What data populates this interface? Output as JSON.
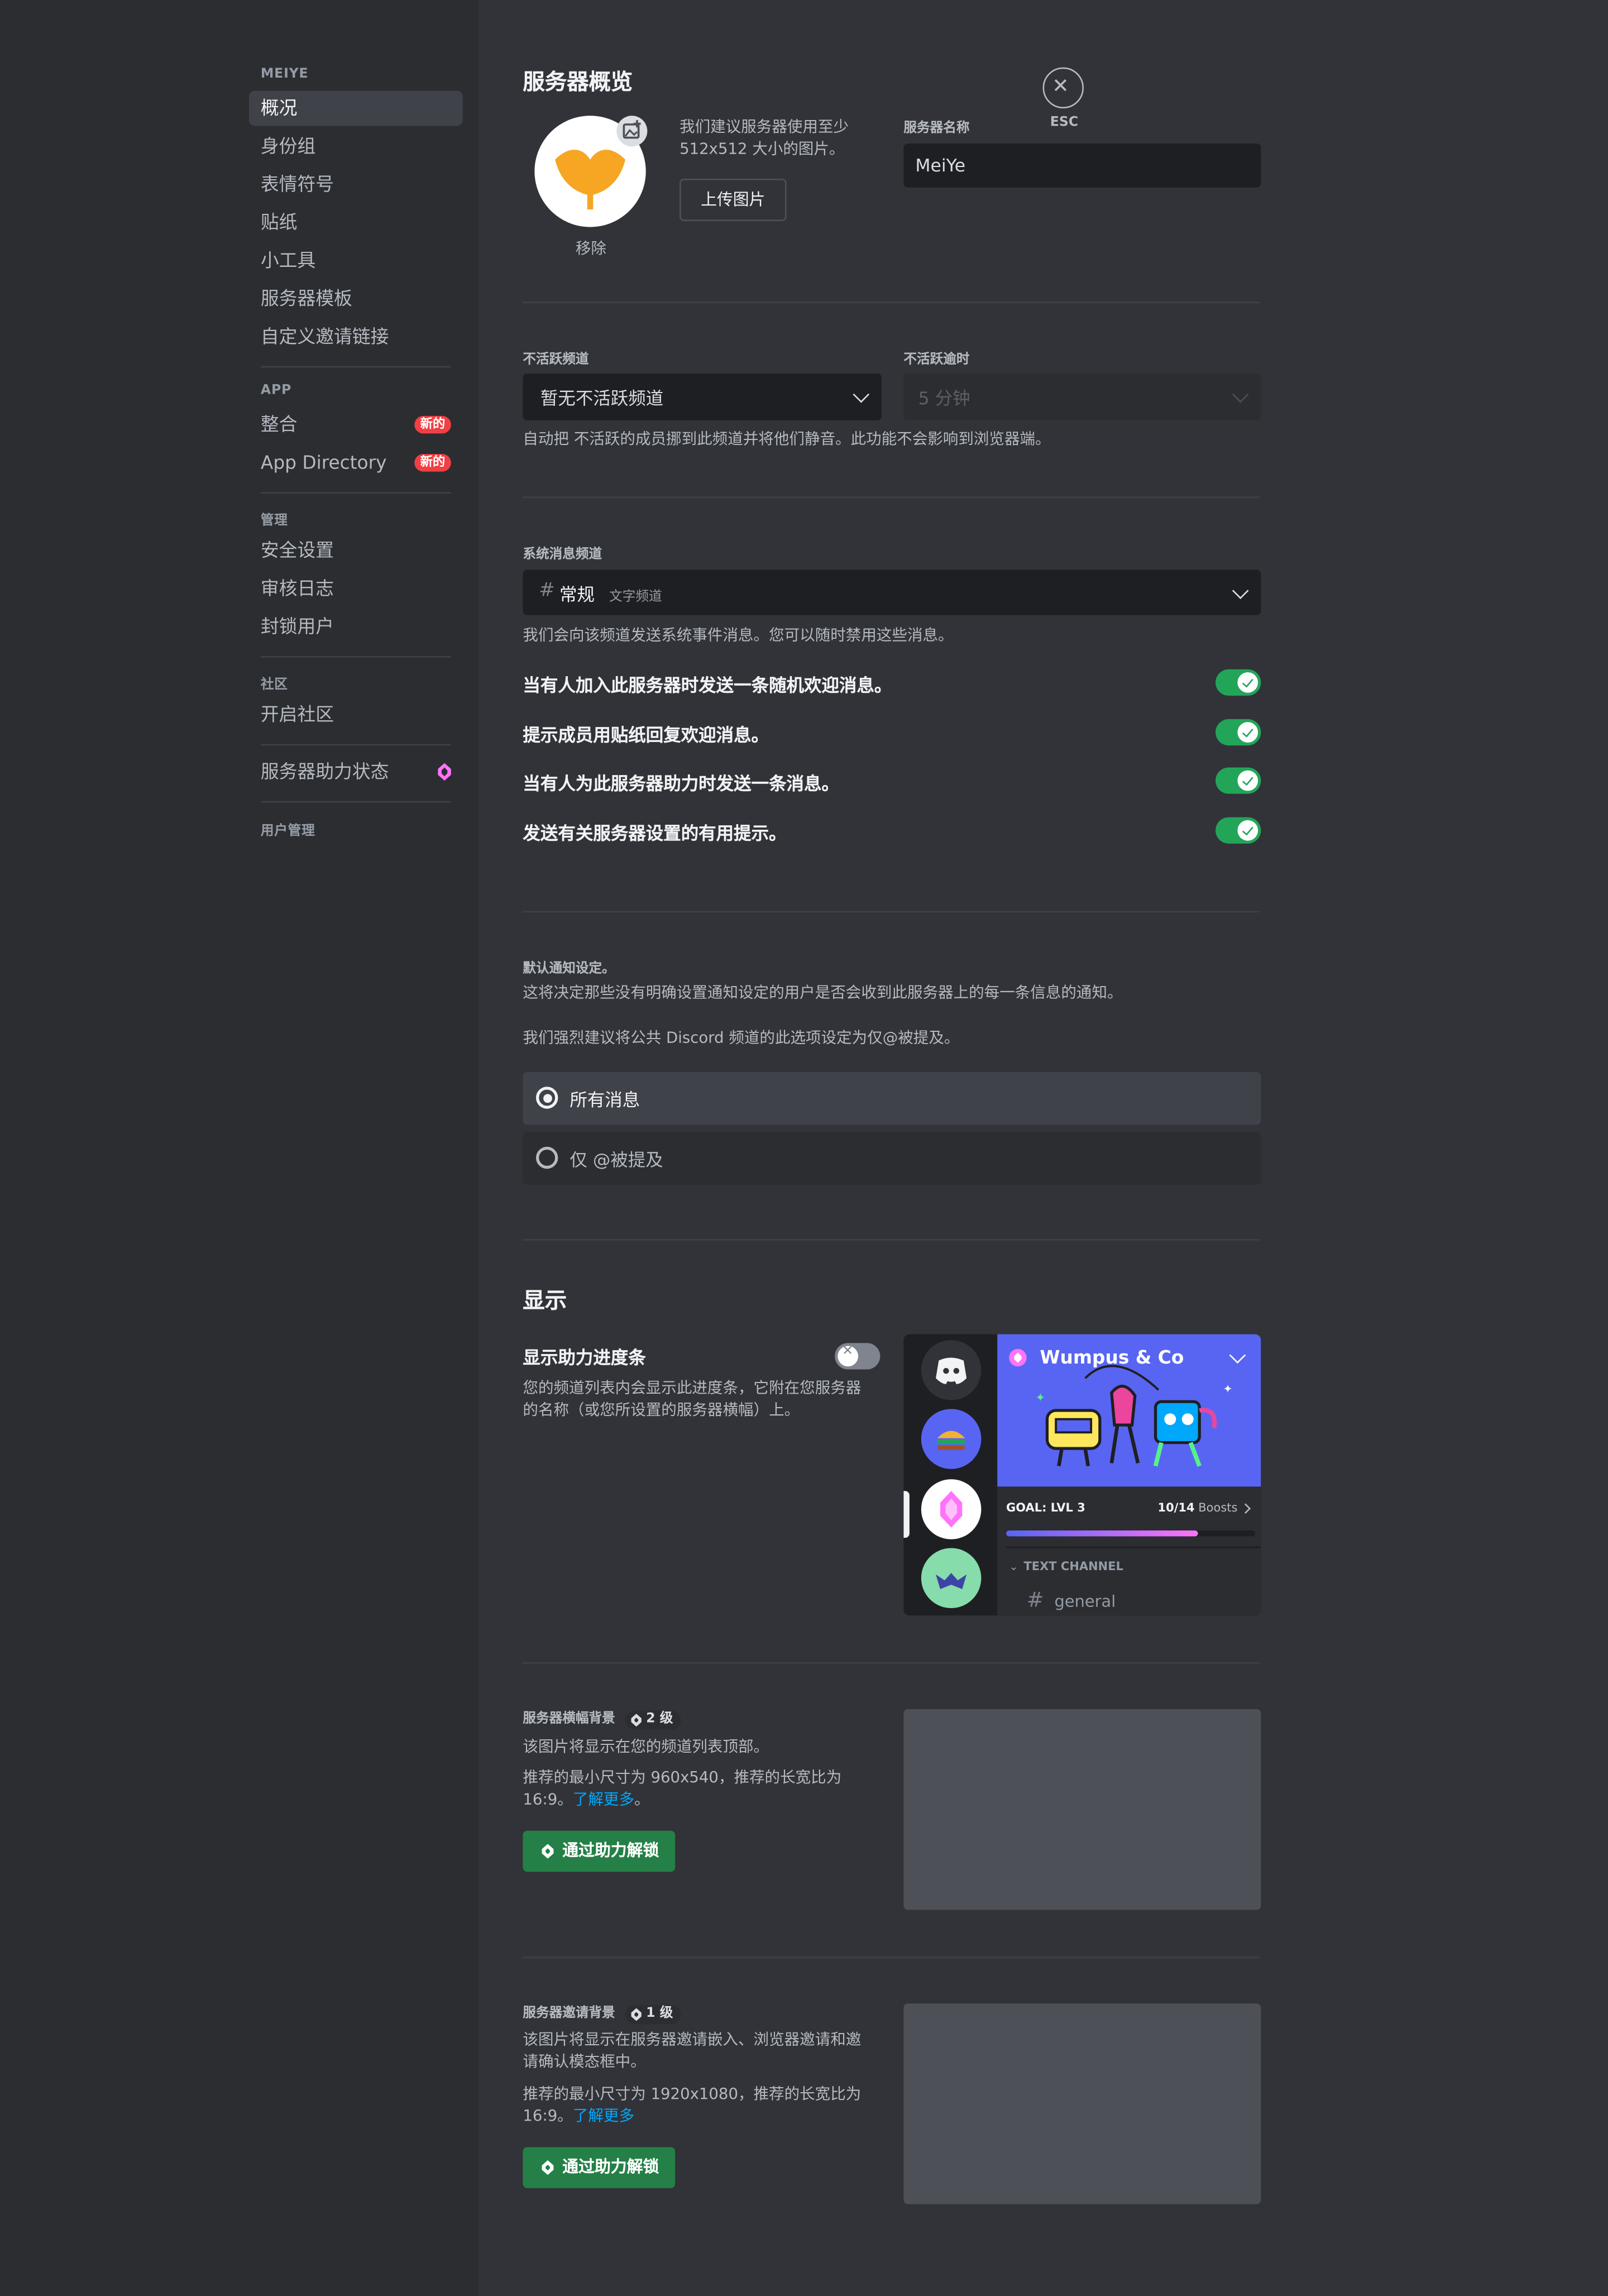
{
  "sidebar": {
    "server_header": "MEIYE",
    "items": [
      {
        "label": "概况"
      },
      {
        "label": "身份组"
      },
      {
        "label": "表情符号"
      },
      {
        "label": "贴纸"
      },
      {
        "label": "小工具"
      },
      {
        "label": "服务器模板"
      },
      {
        "label": "自定义邀请链接"
      }
    ],
    "app_header": "APP",
    "app_items": [
      {
        "label": "整合",
        "badge": "新的"
      },
      {
        "label": "App Directory",
        "badge": "新的"
      }
    ],
    "manage_header": "管理",
    "manage_items": [
      {
        "label": "安全设置"
      },
      {
        "label": "审核日志"
      },
      {
        "label": "封锁用户"
      }
    ],
    "community_header": "社区",
    "community_items": [
      {
        "label": "开启社区"
      }
    ],
    "boost_status": "服务器助力状态",
    "user_mgmt_header": "用户管理"
  },
  "overview": {
    "title": "服务器概览",
    "remove": "移除",
    "upload_hint": "我们建议服务器使用至少 512x512 大小的图片。",
    "upload_button": "上传图片",
    "server_name_label": "服务器名称",
    "server_name_value": "MeiYe",
    "esc": "ESC"
  },
  "inactive": {
    "channel_label": "不活跃频道",
    "channel_value": "暂无不活跃频道",
    "timeout_label": "不活跃逾时",
    "timeout_value": "5 分钟",
    "hint": "自动把 不活跃的成员挪到此频道并将他们静音。此功能不会影响到浏览器端。"
  },
  "system": {
    "label": "系统消息频道",
    "channel_name": "常规",
    "channel_type": "文字频道",
    "hint": "我们会向该频道发送系统事件消息。您可以随时禁用这些消息。",
    "toggles": [
      {
        "label": "当有人加入此服务器时发送一条随机欢迎消息。",
        "on": true
      },
      {
        "label": "提示成员用贴纸回复欢迎消息。",
        "on": true
      },
      {
        "label": "当有人为此服务器助力时发送一条消息。",
        "on": true
      },
      {
        "label": "发送有关服务器设置的有用提示。",
        "on": true
      }
    ]
  },
  "notifications": {
    "label": "默认通知设定。",
    "desc1": "这将决定那些没有明确设置通知设定的用户是否会收到此服务器上的每一条信息的通知。",
    "desc2": "我们强烈建议将公共 Discord 频道的此选项设定为仅@被提及。",
    "options": [
      {
        "label": "所有消息",
        "selected": true
      },
      {
        "label": "仅 @被提及",
        "selected": false
      }
    ]
  },
  "display": {
    "title": "显示",
    "progress_label": "显示助力进度条",
    "progress_on": false,
    "progress_desc": "您的频道列表内会显示此进度条，它附在您服务器的名称（或您所设置的服务器横幅）上。",
    "preview": {
      "server_name": "Wumpus & Co",
      "goal": "GOAL: LVL 3",
      "boosts_count": "10/14",
      "boosts_word": "Boosts",
      "progress": 0.77,
      "category": "TEXT CHANNEL",
      "channel": "general"
    }
  },
  "banner": {
    "label": "服务器横幅背景",
    "level": "2 级",
    "desc": "该图片将显示在您的频道列表顶部。",
    "rec": "推荐的最小尺寸为 960x540，推荐的长宽比为 16:9。",
    "learn_more": "了解更多",
    "tail": "。",
    "button": "通过助力解锁"
  },
  "invite_bg": {
    "label": "服务器邀请背景",
    "level": "1 级",
    "desc": "该图片将显示在服务器邀请嵌入、浏览器邀请和邀请确认模态框中。",
    "rec": "推荐的最小尺寸为 1920x1080，推荐的长宽比为 16:9。",
    "learn_more": "了解更多",
    "button": "通过助力解锁"
  },
  "colors": {
    "accent": "#5865f2",
    "green": "#23a559",
    "button_green": "#248046",
    "danger": "#f23f43",
    "link": "#00a8fc",
    "server_icon_orange": "#f6a623"
  }
}
